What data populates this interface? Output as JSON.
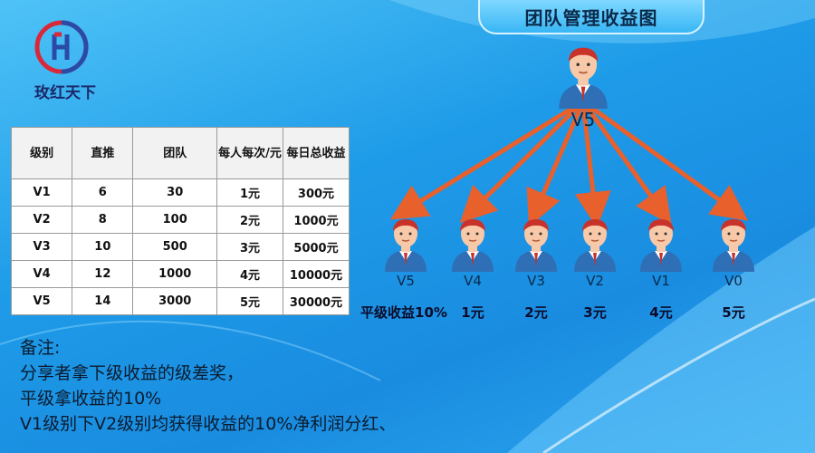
{
  "title": "团队管理收益图",
  "brand": "玫红天下",
  "table": {
    "headers": [
      "级别",
      "直推",
      "团队",
      "每人每次/元",
      "每日总收益"
    ],
    "rows": [
      [
        "V1",
        "6",
        "30",
        "1元",
        "300元"
      ],
      [
        "V2",
        "8",
        "100",
        "2元",
        "1000元"
      ],
      [
        "V3",
        "10",
        "500",
        "3元",
        "5000元"
      ],
      [
        "V4",
        "12",
        "1000",
        "4元",
        "10000元"
      ],
      [
        "V5",
        "14",
        "3000",
        "5元",
        "30000元"
      ]
    ]
  },
  "tree": {
    "root": "V5",
    "children": [
      {
        "label": "V5",
        "reward": "平级收益10%"
      },
      {
        "label": "V4",
        "reward": "1元"
      },
      {
        "label": "V3",
        "reward": "2元"
      },
      {
        "label": "V2",
        "reward": "3元"
      },
      {
        "label": "V1",
        "reward": "4元"
      },
      {
        "label": "V0",
        "reward": "5元"
      }
    ]
  },
  "notes": {
    "heading": "备注:",
    "lines": [
      "分享者拿下级收益的级差奖，",
      "平级拿收益的10%",
      "V1级别下V2级别均获得收益的10%净利润分红、"
    ]
  },
  "colors": {
    "arrow": "#e8602c",
    "suit": "#2f6fb5",
    "skin": "#f7c9a8",
    "hair": "#c8322b"
  }
}
